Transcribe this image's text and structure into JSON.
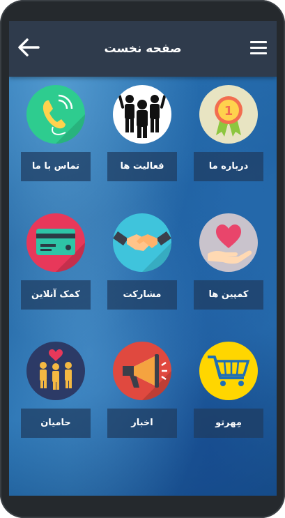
{
  "header": {
    "title": "صفحه نخست",
    "back_icon": "back-arrow-icon",
    "menu_icon": "hamburger-menu-icon"
  },
  "colors": {
    "appbar": "#2f3b4c",
    "tile_label_bg": "#1e3c5f",
    "background": "#2466a6"
  },
  "grid": {
    "items": [
      {
        "label": "درباره ما",
        "icon": "award-medal-icon",
        "circle_color": "#e8e4c2"
      },
      {
        "label": "فعالیت ها",
        "icon": "team-people-icon",
        "circle_color": "#ffffff"
      },
      {
        "label": "تماس با ما",
        "icon": "phone-call-icon",
        "circle_color": "#2ecc8f"
      },
      {
        "label": "کمپین ها",
        "icon": "heart-hand-icon",
        "circle_color": "#c9c3cc"
      },
      {
        "label": "مشارکت",
        "icon": "handshake-icon",
        "circle_color": "#3fc4dc"
      },
      {
        "label": "کمک آنلاین",
        "icon": "credit-card-icon",
        "circle_color": "#e8385a"
      },
      {
        "label": "مِهرتو",
        "icon": "shopping-cart-icon",
        "circle_color": "#ffd600"
      },
      {
        "label": "اخبار",
        "icon": "megaphone-icon",
        "circle_color": "#e0493f"
      },
      {
        "label": "حامیان",
        "icon": "supporters-icon",
        "circle_color": "#2c3a66"
      }
    ]
  }
}
